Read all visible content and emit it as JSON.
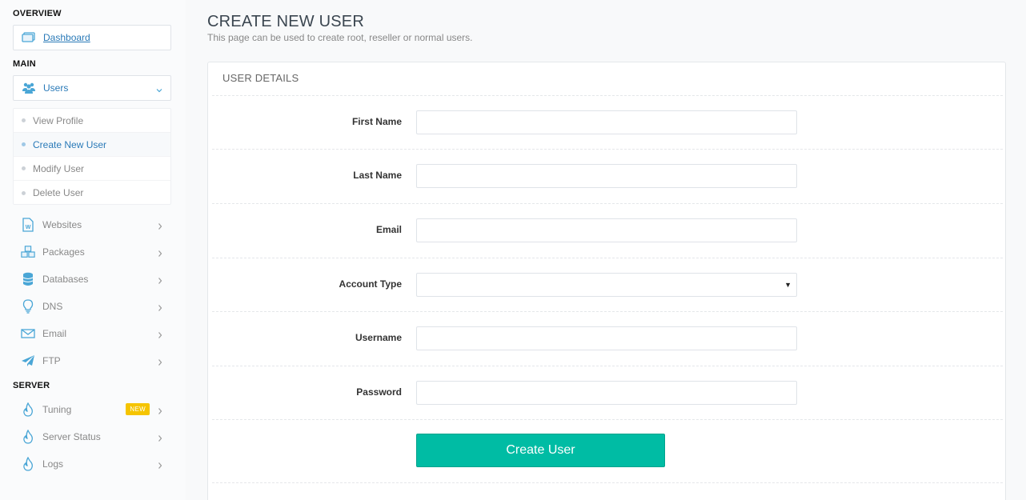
{
  "sidebar": {
    "overview_title": "OVERVIEW",
    "dashboard_label": "Dashboard",
    "main_title": "MAIN",
    "users_label": "Users",
    "users_submenu": [
      "View Profile",
      "Create New User",
      "Modify User",
      "Delete User"
    ],
    "active_submenu": "Create New User",
    "main_items": [
      "Websites",
      "Packages",
      "Databases",
      "DNS",
      "Email",
      "FTP"
    ],
    "server_title": "SERVER",
    "server_items": [
      "Tuning",
      "Server Status",
      "Logs"
    ],
    "tuning_badge": "NEW"
  },
  "page": {
    "title": "CREATE NEW USER",
    "subtitle": "This page can be used to create root, reseller or normal users."
  },
  "form": {
    "panel_title": "USER DETAILS",
    "labels": {
      "first_name": "First Name",
      "last_name": "Last Name",
      "email": "Email",
      "account_type": "Account Type",
      "username": "Username",
      "password": "Password"
    },
    "values": {
      "first_name": "",
      "last_name": "",
      "email": "",
      "account_type": "",
      "username": "",
      "password": ""
    },
    "submit_label": "Create User"
  },
  "colors": {
    "accent": "#00bca4",
    "link": "#2a7ab8",
    "icon": "#4aa6d6",
    "badge": "#f5c400"
  },
  "icons": {
    "dashboard": "monitor-icon",
    "users": "users-icon",
    "websites": "wordpress-file-icon",
    "packages": "cubes-icon",
    "databases": "database-icon",
    "dns": "lightbulb-icon",
    "email": "envelope-icon",
    "ftp": "paper-plane-icon",
    "tuning": "fire-icon",
    "server_status": "fire-icon",
    "logs": "fire-icon"
  }
}
